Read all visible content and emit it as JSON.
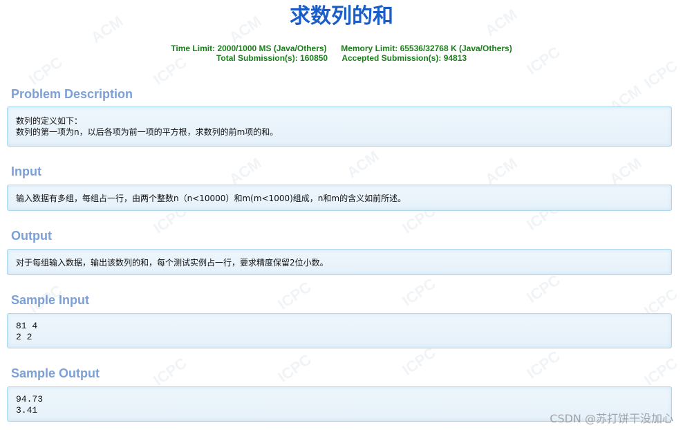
{
  "problem": {
    "title": "求数列的和",
    "time_limit_label": "Time Limit:",
    "time_limit_value": "2000/1000 MS (Java/Others)",
    "memory_limit_label": "Memory Limit:",
    "memory_limit_value": "65536/32768 K (Java/Others)",
    "total_submissions_label": "Total Submission(s):",
    "total_submissions_value": "160850",
    "accepted_submissions_label": "Accepted Submission(s):",
    "accepted_submissions_value": "94813"
  },
  "sections": {
    "description": {
      "heading": "Problem Description",
      "lines": [
        "数列的定义如下：",
        "数列的第一项为n，以后各项为前一项的平方根，求数列的前m项的和。"
      ]
    },
    "input": {
      "heading": "Input",
      "text": "输入数据有多组，每组占一行，由两个整数n（n<10000）和m(m<1000)组成，n和m的含义如前所述。"
    },
    "output": {
      "heading": "Output",
      "text": "对于每组输入数据，输出该数列的和，每个测试实例占一行，要求精度保留2位小数。"
    },
    "sample_input": {
      "heading": "Sample Input",
      "lines": [
        "81 4",
        "2 2"
      ]
    },
    "sample_output": {
      "heading": "Sample Output",
      "lines": [
        "94.73",
        "3.41"
      ]
    }
  },
  "watermark": {
    "bg_words": [
      "ACM",
      "ICPC"
    ],
    "csdn": "CSDN @苏打饼干没加心"
  },
  "colors": {
    "title": "#1a5cc8",
    "limits": "#1a7d1a",
    "heading": "#7ca0d6",
    "panel_border": "#a9d8ef",
    "panel_bg": "#e6f1fa"
  }
}
